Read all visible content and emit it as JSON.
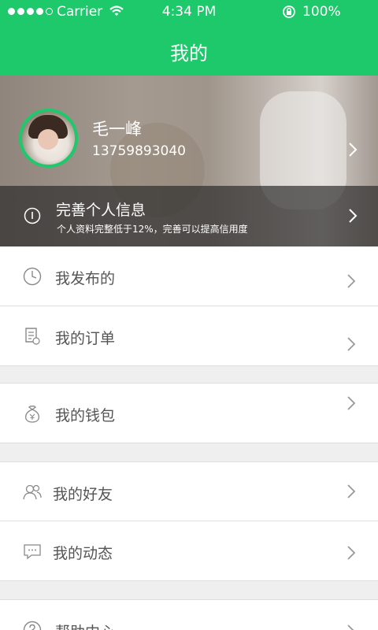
{
  "status_bar": {
    "carrier": "Carrier",
    "time": "4:34 PM",
    "battery": "100%"
  },
  "nav": {
    "title": "我的"
  },
  "profile": {
    "name": "毛一峰",
    "phone": "13759893040",
    "complete_title": "完善个人信息",
    "complete_subtitle": "个人资料完整低于12%，完善可以提高信用度"
  },
  "menu": {
    "items": [
      {
        "label": "我发布的",
        "icon": "clock-icon"
      },
      {
        "label": "我的订单",
        "icon": "order-icon"
      },
      {
        "label": "我的钱包",
        "icon": "wallet-icon"
      },
      {
        "label": "我的好友",
        "icon": "friends-icon"
      },
      {
        "label": "我的动态",
        "icon": "message-icon"
      },
      {
        "label": "帮助中心",
        "icon": "help-icon"
      }
    ]
  },
  "colors": {
    "accent": "#1ec96b",
    "background": "#efefef"
  }
}
